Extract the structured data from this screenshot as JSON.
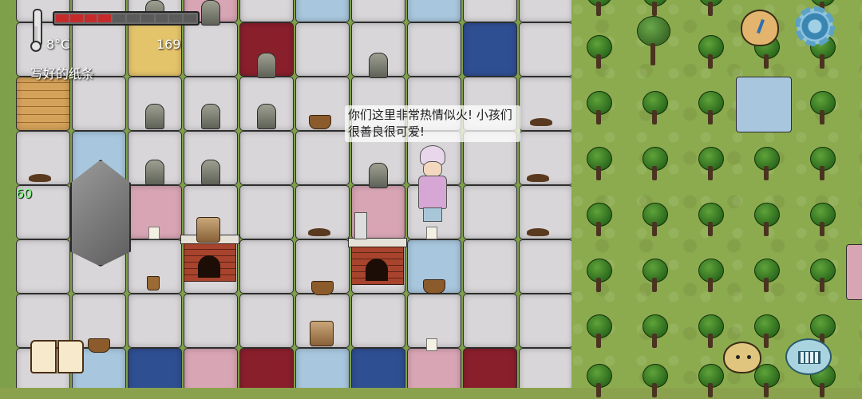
{
  "hud": {
    "temperature": "8°C",
    "food_count": "169",
    "held_item": "写好的纸条",
    "age": "60",
    "food_pips_total": 10,
    "food_pips_filled": 4
  },
  "speech": {
    "text": "你们这里非常热情似火! 小孩们很善良很可爱!"
  },
  "icons": {
    "settings": "gear-icon",
    "clock": "clock-icon",
    "book": "recipe-book-icon",
    "emote": "emote-face-icon",
    "keyboard": "keyboard-icon",
    "thermometer": "thermometer-icon"
  },
  "colors": {
    "food_bar_fill": "#c62b2b",
    "age_text": "#7dff7d",
    "grass": "#8cab4f"
  }
}
